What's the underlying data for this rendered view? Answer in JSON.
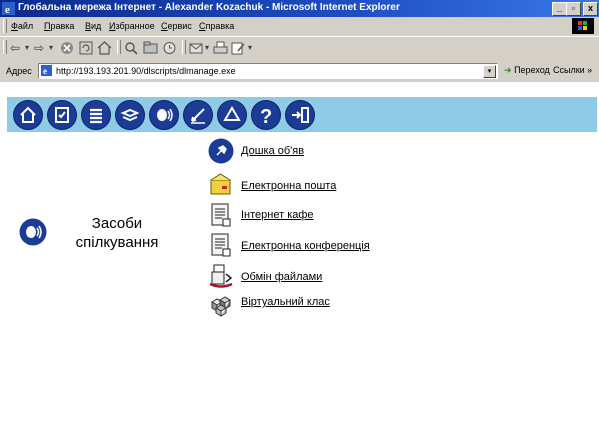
{
  "window": {
    "title": "Глобальна мережа Інтернет - Alexander Kozachuk - Microsoft Internet Explorer",
    "min_glyph": "_",
    "max_glyph": "▫",
    "close_glyph": "x"
  },
  "menubar": {
    "items": [
      {
        "u": "Ф",
        "rest": "айл"
      },
      {
        "u": "П",
        "rest": "равка"
      },
      {
        "u": "В",
        "rest": "ид"
      },
      {
        "u": "И",
        "rest": "збранное"
      },
      {
        "u": "С",
        "rest": "ервис"
      },
      {
        "u": "С",
        "rest": "правка"
      }
    ]
  },
  "toolbar": {
    "back_glyph": "⇦",
    "forward_glyph": "⇨",
    "arrow_glyph": "▾"
  },
  "address": {
    "label": "Адрес",
    "url": "http://193.193.201.90/dlscripts/dlmanage.exe",
    "go_label": "Переход",
    "links_label": "Ссылки »"
  },
  "section": {
    "title_line1": "Засоби",
    "title_line2": "спілкування"
  },
  "links": [
    {
      "label": "Дошка об'яв",
      "icon": "pushpin-icon"
    },
    {
      "label": "Електронна пошта",
      "icon": "envelope-icon"
    },
    {
      "label": "Інтернет кафе",
      "icon": "document-icon"
    },
    {
      "label": "Електронна конференція",
      "icon": "document-icon"
    },
    {
      "label": "Обмін файлами",
      "icon": "file-exchange-icon"
    },
    {
      "label": "Віртуальний клас",
      "icon": "cubes-icon"
    }
  ],
  "colors": {
    "nav_band": "#8fcbe6",
    "nav_icon": "#1b3c96",
    "titlebar": "#0a2a8c"
  }
}
